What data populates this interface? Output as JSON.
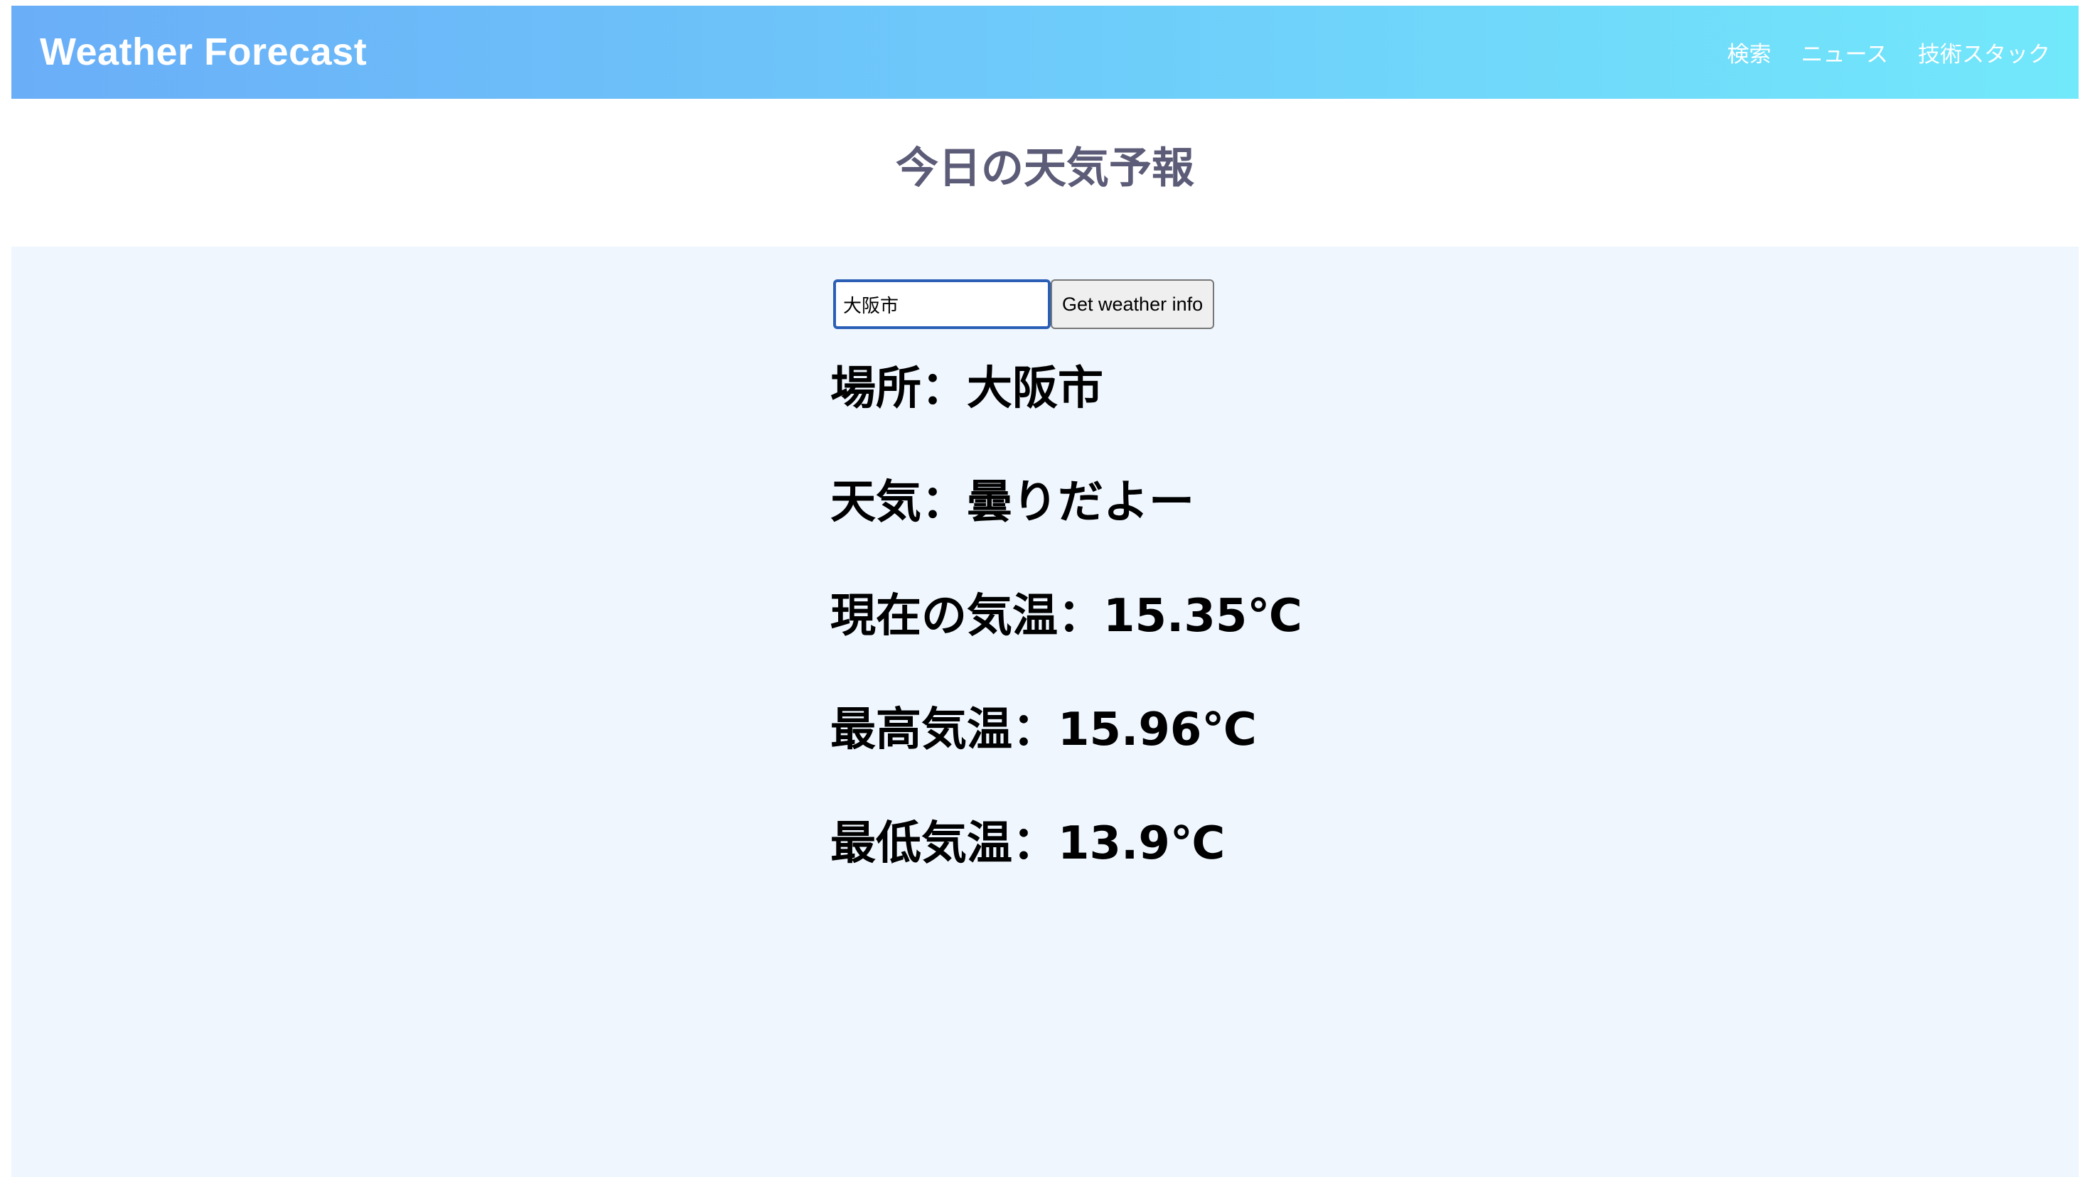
{
  "colors": {
    "header_gradient_start": "#6aaef8",
    "header_gradient_end": "#72e8fb",
    "title_color": "#5c5c78",
    "panel_background": "#eff6fe"
  },
  "header": {
    "brand": "Weather Forecast",
    "nav": [
      {
        "label": "検索"
      },
      {
        "label": "ニュース"
      },
      {
        "label": "技術スタック"
      }
    ]
  },
  "main": {
    "title": "今日の天気予報",
    "search": {
      "value": "大阪市",
      "button_label": "Get weather info"
    },
    "results": {
      "location": "場所：大阪市",
      "weather": "天気：曇りだよー",
      "current_temp": "現在の気温：15.35℃",
      "max_temp": "最高気温：15.96℃",
      "min_temp": "最低気温：13.9℃"
    }
  }
}
